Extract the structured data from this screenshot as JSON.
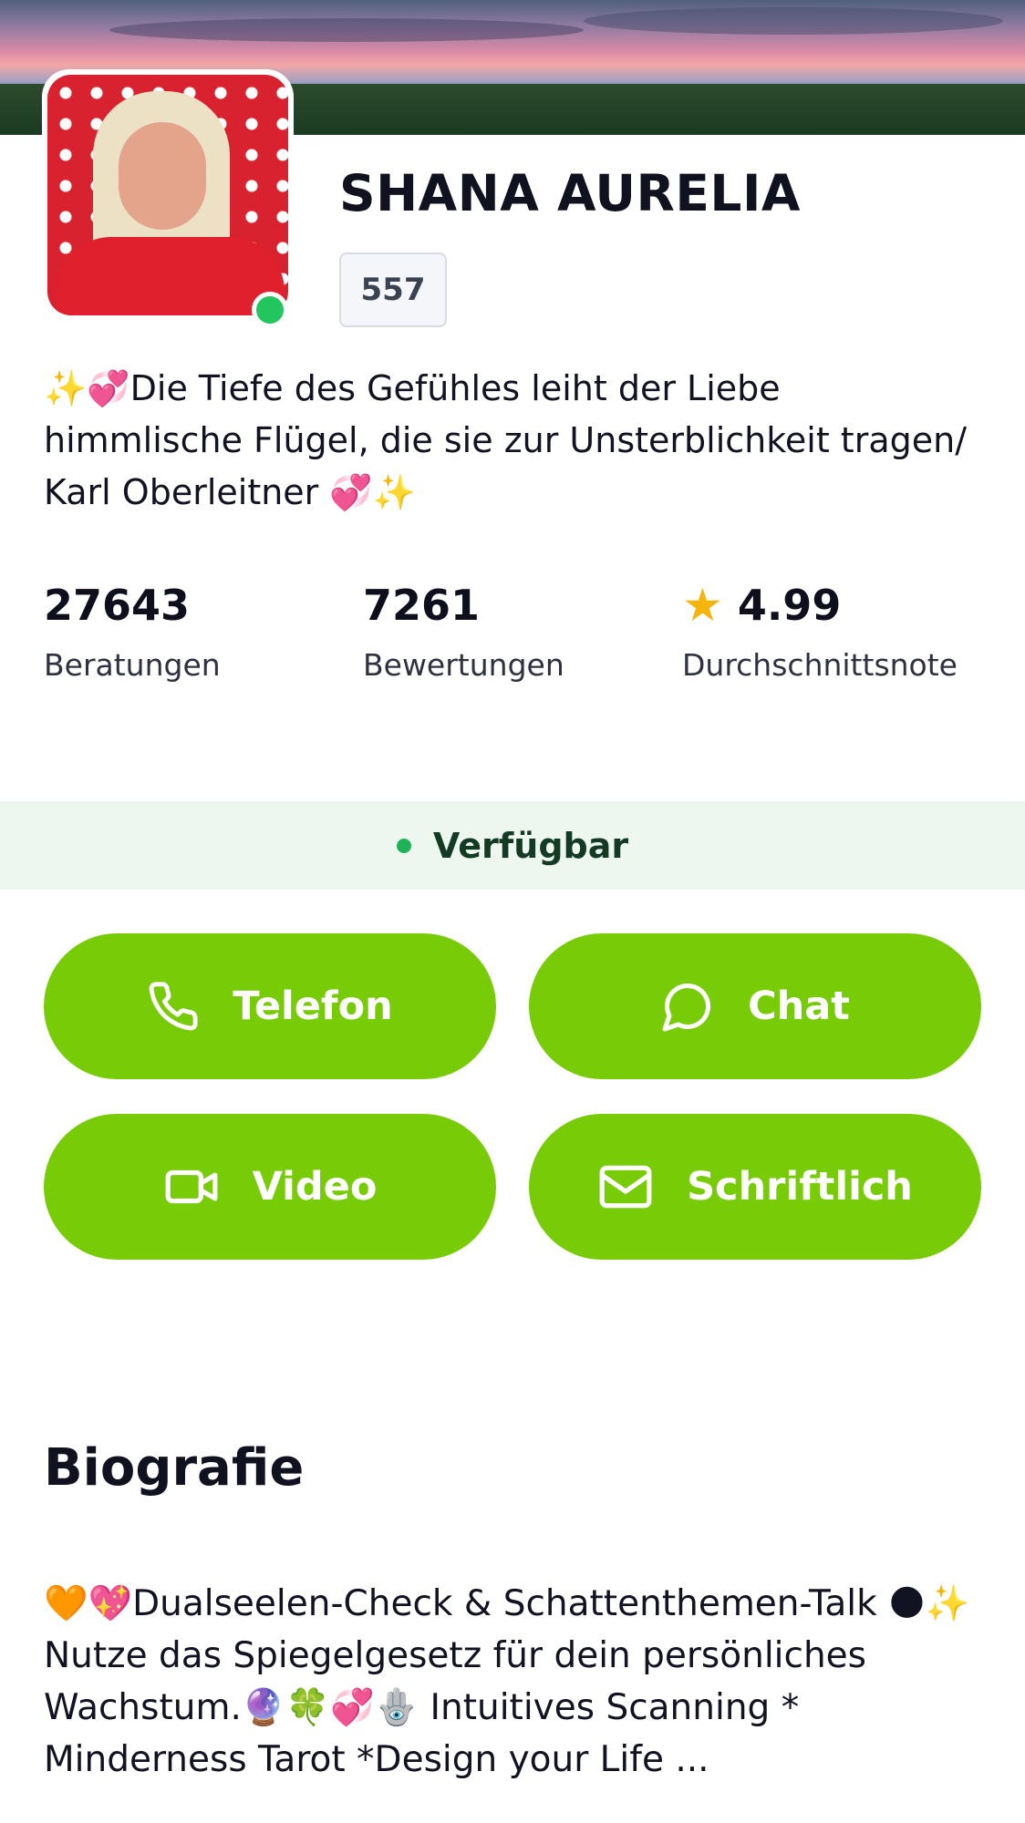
{
  "profile": {
    "name": "SHANA AURELIA",
    "id_badge": "557",
    "tagline": "✨💞Die Tiefe des Gefühles leiht der Liebe himmlische Flügel, die sie zur Unsterblichkeit tragen/ Karl Oberleitner 💞✨",
    "online": true
  },
  "stats": {
    "consultations": {
      "value": "27643",
      "label": "Beratungen"
    },
    "reviews": {
      "value": "7261",
      "label": "Bewertungen"
    },
    "rating": {
      "value": "4.99",
      "label": "Durchschnittsnote"
    }
  },
  "availability": {
    "label": "Verfügbar",
    "color": "#1eb356"
  },
  "actions": {
    "phone": "Telefon",
    "chat": "Chat",
    "video": "Video",
    "written": "Schriftlich",
    "button_color": "#78cc07"
  },
  "biography": {
    "title": "Biografie",
    "text": "🧡💖Dualseelen-Check & Schattenthemen-Talk 🌑✨ Nutze das Spiegelgesetz für dein persönliches Wachstum.🔮🍀💞🪬 Intuitives Scanning * Minderness Tarot *Design your Life ..."
  },
  "icons": [
    "phone-icon",
    "chat-bubble-icon",
    "video-camera-icon",
    "envelope-icon",
    "star-icon"
  ]
}
